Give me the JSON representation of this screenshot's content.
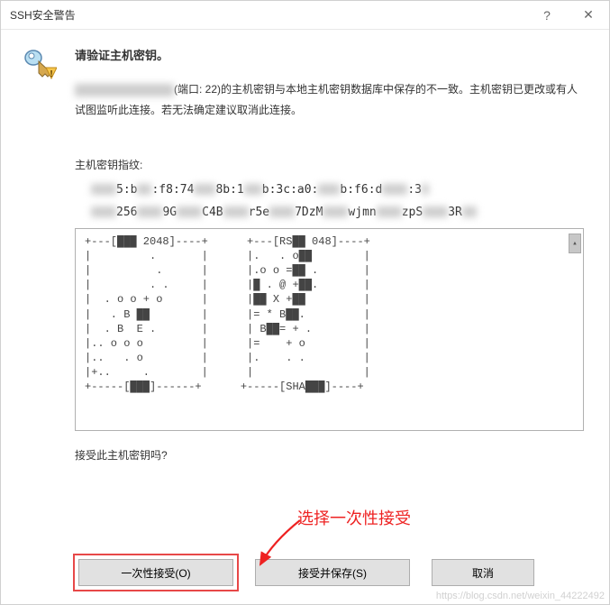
{
  "titlebar": {
    "title": "SSH安全警告",
    "help": "?",
    "close": "✕"
  },
  "heading": "请验证主机密钥。",
  "body": {
    "prefix_masked": "███.███.██.███",
    "port_part": "(端口: 22)的主机密钥与本地主机密钥数据库中保存的不一致。主机密钥已更改或有人试图监听此连接。若无法确定建议取消此连接。"
  },
  "fingerprint": {
    "label": "主机密钥指纹:",
    "line1": "███5:b██:f8:74███8b:1██b:3c:a0:███b:f6:d███:3█",
    "line2": "███256███9G███C4B███r5e███7DzM███wjmn███zpS███3R██"
  },
  "art": "+---[███ 2048]----+      +---[RS██ 048]----+\n|         .       |      |.   . o██        |\n|          .      |      |.o o =██ .       |\n|         . .     |      |█ . @ +██.       |\n|  . o o + o      |      |██ X +██         |\n|   . B ██        |      |= * B██.         |\n|  . B  E .       |      | B██= + .        |\n|.. o o o         |      |=    + o         |\n|..   . o         |      |.    . .         |\n|+..     .        |      |                 |\n+-----[███]------+      +-----[SHA███]----+",
  "annotation": "选择一次性接受",
  "question": "接受此主机密钥吗?",
  "buttons": {
    "once": "一次性接受(O)",
    "save": "接受并保存(S)",
    "cancel": "取消"
  },
  "watermark": "https://blog.csdn.net/weixin_44222492"
}
